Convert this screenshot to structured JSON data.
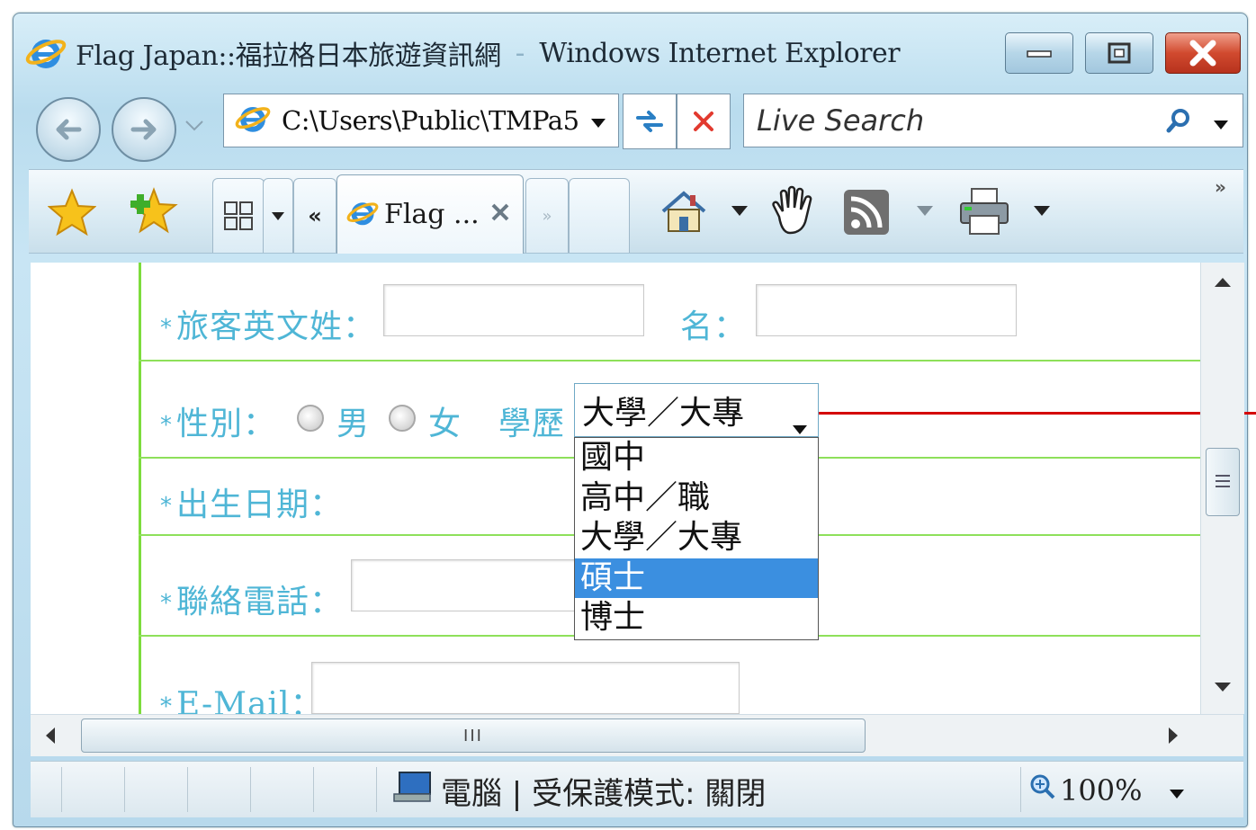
{
  "window": {
    "site_title": "Flag Japan::福拉格日本旅遊資訊網",
    "separator": "-",
    "app_name": "Windows Internet Explorer"
  },
  "navigation": {
    "address": "C:\\Users\\Public\\TMPa5"
  },
  "search": {
    "placeholder": "Live Search"
  },
  "tabs": {
    "group_chevron": "«",
    "active_label": "Flag ...",
    "more": "»"
  },
  "form": {
    "surname_label": "旅客英文姓：",
    "given_label": "名：",
    "gender_label": "性別：",
    "male": "男",
    "female": "女",
    "education_label": "學歷",
    "education_selected": "大學／大專",
    "education_options": [
      "國中",
      "高中／職",
      "大學／大專",
      "碩士",
      "博士"
    ],
    "birth_label": "出生日期：",
    "phone_label": "聯絡電話：",
    "email_label": "E-Mail：",
    "required_mark": "*"
  },
  "scrollbar": {
    "grip": "III"
  },
  "statusbar": {
    "zone": "電腦 | 受保護模式: 關閉",
    "zoom": "100%"
  },
  "colors": {
    "label_blue": "#4fb6d6",
    "grid_green": "#7ddc3c",
    "selection_blue": "#3b8fe0",
    "callout_red": "#d40000"
  }
}
